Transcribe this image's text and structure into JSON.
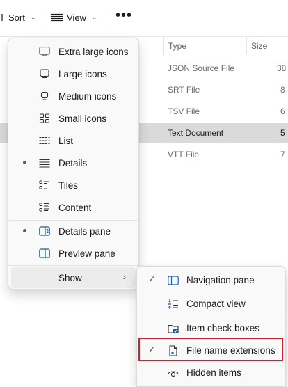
{
  "toolbar": {
    "sort_label": "Sort",
    "view_label": "View",
    "more_label": "•••"
  },
  "columns": {
    "type": "Type",
    "size": "Size"
  },
  "files": [
    {
      "type": "JSON Source File",
      "size": "38",
      "selected": false
    },
    {
      "type": "SRT File",
      "size": "8",
      "selected": false
    },
    {
      "type": "TSV File",
      "size": "6",
      "selected": false
    },
    {
      "type": "Text Document",
      "size": "5",
      "selected": true
    },
    {
      "type": "VTT File",
      "size": "7",
      "selected": false
    }
  ],
  "view_menu": {
    "items": [
      {
        "label": "Extra large icons",
        "icon": "extra-large-icons-icon",
        "bullet": false
      },
      {
        "label": "Large icons",
        "icon": "large-icons-icon",
        "bullet": false
      },
      {
        "label": "Medium icons",
        "icon": "medium-icons-icon",
        "bullet": false
      },
      {
        "label": "Small icons",
        "icon": "small-icons-icon",
        "bullet": false
      },
      {
        "label": "List",
        "icon": "list-icon",
        "bullet": false
      },
      {
        "label": "Details",
        "icon": "details-icon",
        "bullet": true
      },
      {
        "label": "Tiles",
        "icon": "tiles-icon",
        "bullet": false
      },
      {
        "label": "Content",
        "icon": "content-icon",
        "bullet": false
      }
    ],
    "panes": [
      {
        "label": "Details pane",
        "icon": "details-pane-icon",
        "bullet": true
      },
      {
        "label": "Preview pane",
        "icon": "preview-pane-icon",
        "bullet": false
      }
    ],
    "show_label": "Show"
  },
  "show_menu": {
    "items": [
      {
        "label": "Navigation pane",
        "icon": "navigation-pane-icon",
        "checked": true
      },
      {
        "label": "Compact view",
        "icon": "compact-view-icon",
        "checked": false
      },
      {
        "label": "Item check boxes",
        "icon": "item-check-boxes-icon",
        "checked": false
      },
      {
        "label": "File name extensions",
        "icon": "file-name-extensions-icon",
        "checked": true
      },
      {
        "label": "Hidden items",
        "icon": "hidden-items-icon",
        "checked": false
      }
    ]
  },
  "colors": {
    "accent": "#1a5fb4",
    "highlight_border": "#d21d2a",
    "selected_row": "#dadada"
  }
}
